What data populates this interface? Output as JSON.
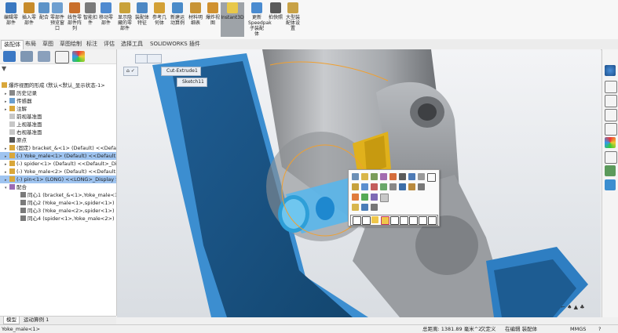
{
  "ribbon": {
    "buttons": [
      {
        "label": "编辑零\n部件",
        "icon": "edit-part-icon"
      },
      {
        "label": "插入零\n部件",
        "icon": "insert-component-icon"
      },
      {
        "label": "配合",
        "icon": "mate-icon"
      },
      {
        "label": "零部件\n预览窗\n口",
        "icon": "component-preview-icon"
      },
      {
        "label": "线性零\n部件阵\n列",
        "icon": "linear-pattern-icon"
      },
      {
        "label": "智能扣\n件",
        "icon": "smart-fastener-icon"
      },
      {
        "label": "移动零\n部件",
        "icon": "move-component-icon"
      },
      {
        "label": "显示隐\n藏的零\n部件",
        "icon": "show-hidden-icon"
      },
      {
        "label": "装配体\n特征",
        "icon": "assembly-feature-icon"
      },
      {
        "label": "参考几\n何体",
        "icon": "reference-geometry-icon"
      },
      {
        "label": "新建运\n动算例",
        "icon": "new-motion-study-icon"
      },
      {
        "label": "材料明\n细表",
        "icon": "bom-icon"
      },
      {
        "label": "爆炸视\n图",
        "icon": "exploded-view-icon"
      },
      {
        "label": "Instant3D",
        "icon": "instant3d-icon"
      },
      {
        "label": "更新\nSpeedpak\n子装配体",
        "icon": "speedpak-icon"
      },
      {
        "label": "拍快照",
        "icon": "snapshot-icon"
      },
      {
        "label": "大型装\n配体设\n置",
        "icon": "large-assembly-icon"
      }
    ]
  },
  "tabs": [
    "装配体",
    "布局",
    "草图",
    "草图绘制",
    "标注",
    "评估",
    "选择工具",
    "SOLIDWORKS 插件"
  ],
  "tree": {
    "root": "爆炸视图的形成 (默认<默认_显示状态-1>",
    "items": [
      {
        "label": "历史记录",
        "icon": "history-icon"
      },
      {
        "label": "传感器",
        "icon": "sensor-icon"
      },
      {
        "label": "注解",
        "icon": "annotation-icon"
      },
      {
        "label": "前视基准面",
        "icon": "plane-icon"
      },
      {
        "label": "上视基准面",
        "icon": "plane-icon"
      },
      {
        "label": "右视基准面",
        "icon": "plane-icon"
      },
      {
        "label": "原点",
        "icon": "origin-icon"
      },
      {
        "label": "(固定) bracket_&<1> (Default) <<Default>",
        "icon": "part-icon"
      },
      {
        "label": "(-) Yoke_male<1> (Default) <<Default>_Di",
        "icon": "part-icon",
        "hl": true
      },
      {
        "label": "(-) spider<1> (Default) <<Default>_Display",
        "icon": "part-icon"
      },
      {
        "label": "(-) Yoke_male<2> (Default) <<Default>_Di",
        "icon": "part-icon"
      },
      {
        "label": "(-) pin<1> (LONG) <<LONG>_Display State",
        "icon": "part-icon",
        "hl": true
      },
      {
        "label": "配合",
        "icon": "mates-folder-icon"
      },
      {
        "label": "同心1 (bracket_&<1>,Yoke_male<1>)",
        "icon": "concentric-icon"
      },
      {
        "label": "同心2 (Yoke_male<1>,spider<1>)",
        "icon": "concentric-icon"
      },
      {
        "label": "同心3 (Yoke_male<2>,spider<1>)",
        "icon": "concentric-icon"
      },
      {
        "label": "同心4 (spider<1>,Yoke_male<2>)",
        "icon": "concentric-icon"
      }
    ]
  },
  "bottom_tabs": [
    "模型",
    "运动算例 1"
  ],
  "flyout": {
    "feature": "Cut-Extrude1",
    "sketch": "Sketch11"
  },
  "status": {
    "selection": "Yoke_male<1>",
    "distance": "总距离: 1381.89 毫米^2",
    "defined": "欠定义",
    "mode": "在编辑 装配体",
    "units": "MMGS"
  }
}
